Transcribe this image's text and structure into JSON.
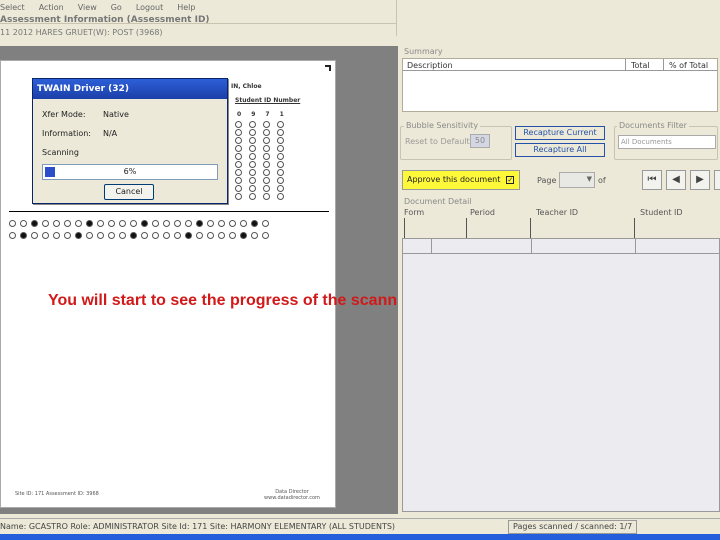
{
  "menu": [
    "Select",
    "Action",
    "View",
    "Go",
    "Logout",
    "Help"
  ],
  "header": {
    "title": "Assessment Information (Assessment ID)",
    "subtitle": "11 2012 HARES GRUET(W): POST (3968)"
  },
  "twain": {
    "title": "TWAIN Driver (32)",
    "mode_label": "Xfer Mode:",
    "mode_value": "Native",
    "info_label": "Information:",
    "info_value": "N/A",
    "status": "Scanning",
    "progress_text": "6%",
    "progress_fraction": 0.06,
    "cancel_label": "Cancel"
  },
  "scan_form": {
    "student_name_fragment": "IN, Chloe",
    "student_id_label": "Student ID Number",
    "student_id_digits": [
      "0",
      "9",
      "7",
      "1"
    ],
    "footer_left": "Site ID: 171   Assessment ID: 3968",
    "footer_right": "Data Director www.datadirector.com"
  },
  "callout": "You will start to see the progress of the scanning",
  "summary": {
    "label": "Summary",
    "columns": [
      "Description",
      "Total",
      "% of Total"
    ]
  },
  "bubble_sensitivity": {
    "label": "Bubble Sensitivity",
    "reset_label": "Reset to Default",
    "value": "50"
  },
  "buttons": {
    "recapture_current": "Recapture Current",
    "recapture_all": "Recapture All"
  },
  "documents_filter": {
    "label": "Documents Filter",
    "value": "All Documents"
  },
  "approve": {
    "label": "Approve this document",
    "checked": true
  },
  "page_nav": {
    "page_label": "Page",
    "of_label": "of"
  },
  "document_detail": {
    "label": "Document Detail",
    "columns": [
      "Form",
      "Period",
      "Teacher ID",
      "Student ID"
    ]
  },
  "status": {
    "left": "Name: GCASTRO  Role: ADMINISTRATOR  Site Id: 171  Site: HARMONY ELEMENTARY (ALL STUDENTS)",
    "right": "Pages scanned / scanned: 1/7"
  },
  "colors": {
    "dialog_title": "#1c3fa8",
    "progress": "#2b4fc9",
    "callout": "#d21919",
    "approve_bg": "#fdf93a",
    "button_text": "#2452a8"
  }
}
